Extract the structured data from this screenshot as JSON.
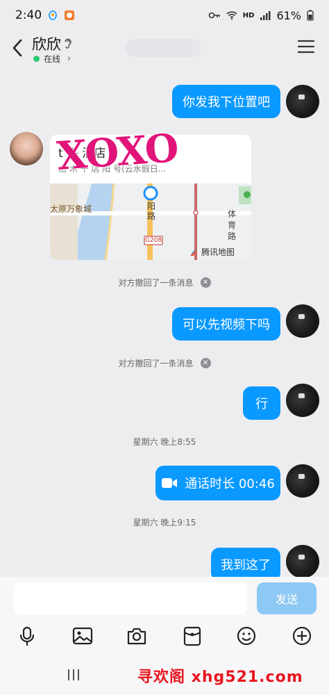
{
  "status": {
    "time": "2:40",
    "battery": "61%",
    "network": "HD"
  },
  "header": {
    "title": "欣欣",
    "status": "在线"
  },
  "location": {
    "title": "t 平 酒店",
    "address": "山 木 干 店 阳 号(云水假日...",
    "map_labels": {
      "mall": "太原万象城",
      "road": "阳\n路",
      "road2": "体\n育\n路",
      "highway": "G208",
      "brand": "腾讯地图"
    },
    "sticker": "XOXO"
  },
  "messages": [
    {
      "side": "me",
      "text": "你发我下位置吧"
    },
    {
      "side": "me",
      "text": "可以先视频下吗"
    },
    {
      "side": "me",
      "text": "行"
    },
    {
      "side": "me",
      "text": "通话时长 00:46"
    },
    {
      "side": "me",
      "text": "我到这了"
    }
  ],
  "notices": [
    "对方撤回了一条消息",
    "对方撤回了一条消息"
  ],
  "times": [
    "星期六 晚上8:55",
    "星期六 晚上9:15"
  ],
  "input": {
    "value": "",
    "send_label": "发送"
  },
  "toolbar_icons": [
    "mic-icon",
    "image-icon",
    "camera-icon",
    "red-packet-icon",
    "emoji-icon",
    "plus-icon"
  ],
  "watermark": "寻欢阁 xhg521.com"
}
